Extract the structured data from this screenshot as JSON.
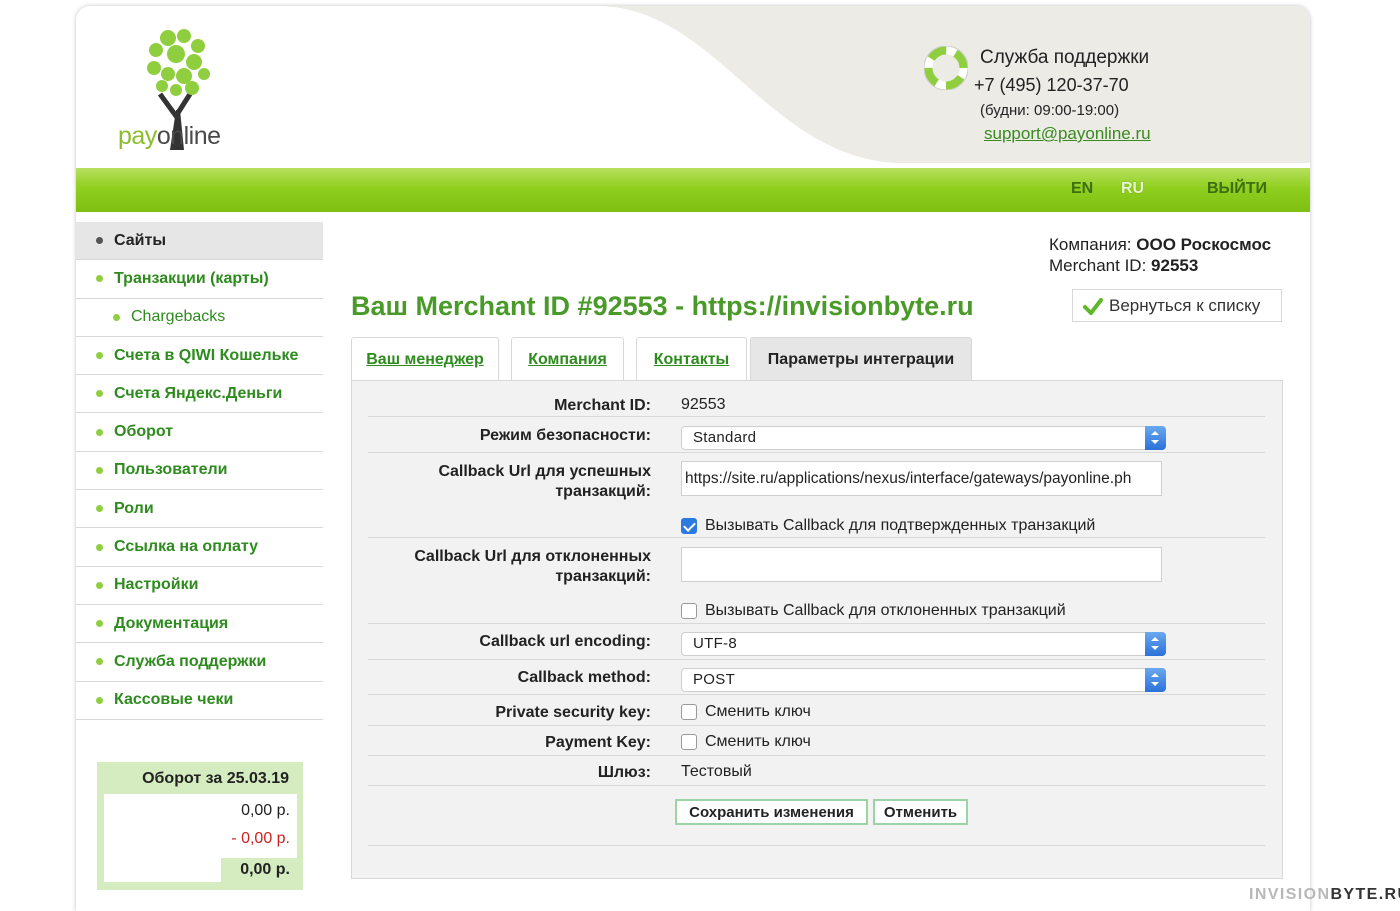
{
  "logo": {
    "pay": "pay",
    "online": "online"
  },
  "support": {
    "title": "Служба поддержки",
    "phone": "+7 (495) 120-37-70",
    "hours": "(будни: 09:00-19:00)",
    "email": "support@payonline.ru"
  },
  "topbar": {
    "lang_en": "EN",
    "lang_ru": "RU",
    "logout": "ВЫЙТИ"
  },
  "sidebar": {
    "items": [
      {
        "label": "Сайты"
      },
      {
        "label": "Транзакции (карты)"
      },
      {
        "label": "Chargebacks"
      },
      {
        "label": "Счета в QIWI Кошельке"
      },
      {
        "label": "Счета Яндекс.Деньги"
      },
      {
        "label": "Оборот"
      },
      {
        "label": "Пользователи"
      },
      {
        "label": "Роли"
      },
      {
        "label": "Ссылка на оплату"
      },
      {
        "label": "Настройки"
      },
      {
        "label": "Документация"
      },
      {
        "label": "Служба поддержки"
      },
      {
        "label": "Кассовые чеки"
      }
    ]
  },
  "turnover": {
    "title": "Оборот за 25.03.19",
    "income": "0,00 р.",
    "refunds": "- 0,00 р.",
    "total": "0,00 р."
  },
  "company": {
    "label": "Компания:",
    "name": "ООО Роскосмос",
    "merchant_label": "Merchant ID:",
    "merchant_id": "92553"
  },
  "main": {
    "title": "Ваш Merchant ID #92553 - https://invisionbyte.ru",
    "back_button": "Вернуться к списку"
  },
  "tabs": [
    {
      "label": "Ваш менеджер"
    },
    {
      "label": "Компания"
    },
    {
      "label": "Контакты"
    },
    {
      "label": "Параметры интеграции"
    }
  ],
  "form": {
    "merchant_id_label": "Merchant ID:",
    "merchant_id_value": "92553",
    "security_mode_label": "Режим безопасности:",
    "security_mode_value": "Standard",
    "callback_success_label_1": "Callback Url для успешных",
    "callback_success_label_2": "транзакций:",
    "callback_success_value": "https://site.ru/applications/nexus/interface/gateways/payonline.ph",
    "callback_success_checkbox": "Вызывать Callback для подтвержденных транзакций",
    "callback_fail_label_1": "Callback Url для отклоненных",
    "callback_fail_label_2": "транзакций:",
    "callback_fail_value": "",
    "callback_fail_checkbox": "Вызывать Callback для отклоненных транзакций",
    "encoding_label": "Callback url encoding:",
    "encoding_value": "UTF-8",
    "method_label": "Callback method:",
    "method_value": "POST",
    "private_key_label": "Private security key:",
    "private_key_checkbox": "Сменить ключ",
    "payment_key_label": "Payment Key:",
    "payment_key_checkbox": "Сменить ключ",
    "gateway_label": "Шлюз:",
    "gateway_value": "Тестовый",
    "save_button": "Сохранить изменения",
    "cancel_button": "Отменить"
  },
  "watermark": {
    "part1": "INVISION",
    "part2": "BYTE.RU"
  }
}
